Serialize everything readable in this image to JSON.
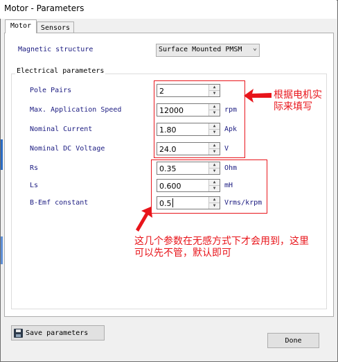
{
  "window": {
    "title": "Motor - Parameters"
  },
  "tabs": [
    {
      "label": "Motor",
      "active": true
    },
    {
      "label": "Sensors",
      "active": false
    }
  ],
  "magnetic": {
    "label": "Magnetic structure",
    "value": "Surface Mounted PMSM"
  },
  "electrical": {
    "group_title": "Electrical parameters",
    "fields": [
      {
        "label": "Pole Pairs",
        "value": "2",
        "unit": ""
      },
      {
        "label": "Max. Application Speed",
        "value": "12000",
        "unit": "rpm"
      },
      {
        "label": "Nominal Current",
        "value": "1.80",
        "unit": "Apk"
      },
      {
        "label": "Nominal DC Voltage",
        "value": "24.0",
        "unit": "V"
      },
      {
        "label": "Rs",
        "value": "0.35",
        "unit": "Ohm"
      },
      {
        "label": "Ls",
        "value": "0.600",
        "unit": "mH"
      },
      {
        "label": "B-Emf constant",
        "value": "0.5",
        "unit": "Vrms/krpm"
      }
    ]
  },
  "annotations": {
    "note1": "根据电机实\n际来填写",
    "note2": "这几个参数在无感方式下才会用到，这里\n可以先不管，默认即可"
  },
  "buttons": {
    "save": "Save parameters",
    "done": "Done"
  },
  "colors": {
    "annotation": "#e8141a",
    "label_text": "#1a1a80"
  }
}
